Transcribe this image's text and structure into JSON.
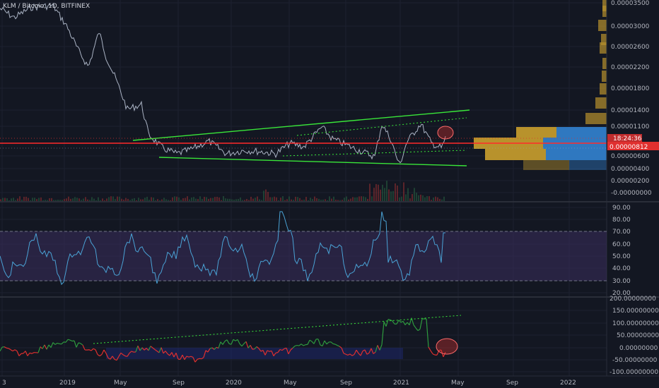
{
  "header": {
    "title": "KLM / Bitcoin, 1D, BITFINEX"
  },
  "colors": {
    "bg": "#131722",
    "grid": "#1f2430",
    "price": "#aab3c4",
    "trend": "#39e639",
    "level": "#ff2a2a",
    "rsi": "#4aa3d6",
    "rsi_band": "#3b2d5c",
    "osc_up": "#2e9a3e",
    "osc_down": "#e0302f",
    "accent_badge": "#e0302f",
    "profile_gold": "#b8922c",
    "profile_blue": "#2f78c0",
    "ellipse": "#ff6b6b"
  },
  "price_axis": {
    "ticks": [
      "0.00003500",
      "0.00003000",
      "0.00002600",
      "0.00002200",
      "0.00001800",
      "0.00001400",
      "0.00001100",
      "0.00000600",
      "0.00000400",
      "0.00000200",
      "-0.00000000"
    ],
    "countdown": "18:24:36",
    "last_price": "0.00000812"
  },
  "rsi_axis": {
    "ticks": [
      "90.00",
      "80.00",
      "70.00",
      "60.00",
      "50.00",
      "40.00",
      "30.00",
      "20.00"
    ]
  },
  "osc_axis": {
    "ticks": [
      "200.00000000",
      "150.00000000",
      "100.00000000",
      "50.00000000",
      "0.00000000",
      "-50.00000000",
      "-100.00000000"
    ]
  },
  "time_axis": {
    "ticks": [
      "3",
      "2019",
      "May",
      "Sep",
      "2020",
      "May",
      "Sep",
      "2021",
      "May",
      "Sep",
      "2022"
    ]
  },
  "icons": {
    "ellipse_marker": "ellipse-annotation-icon"
  }
}
